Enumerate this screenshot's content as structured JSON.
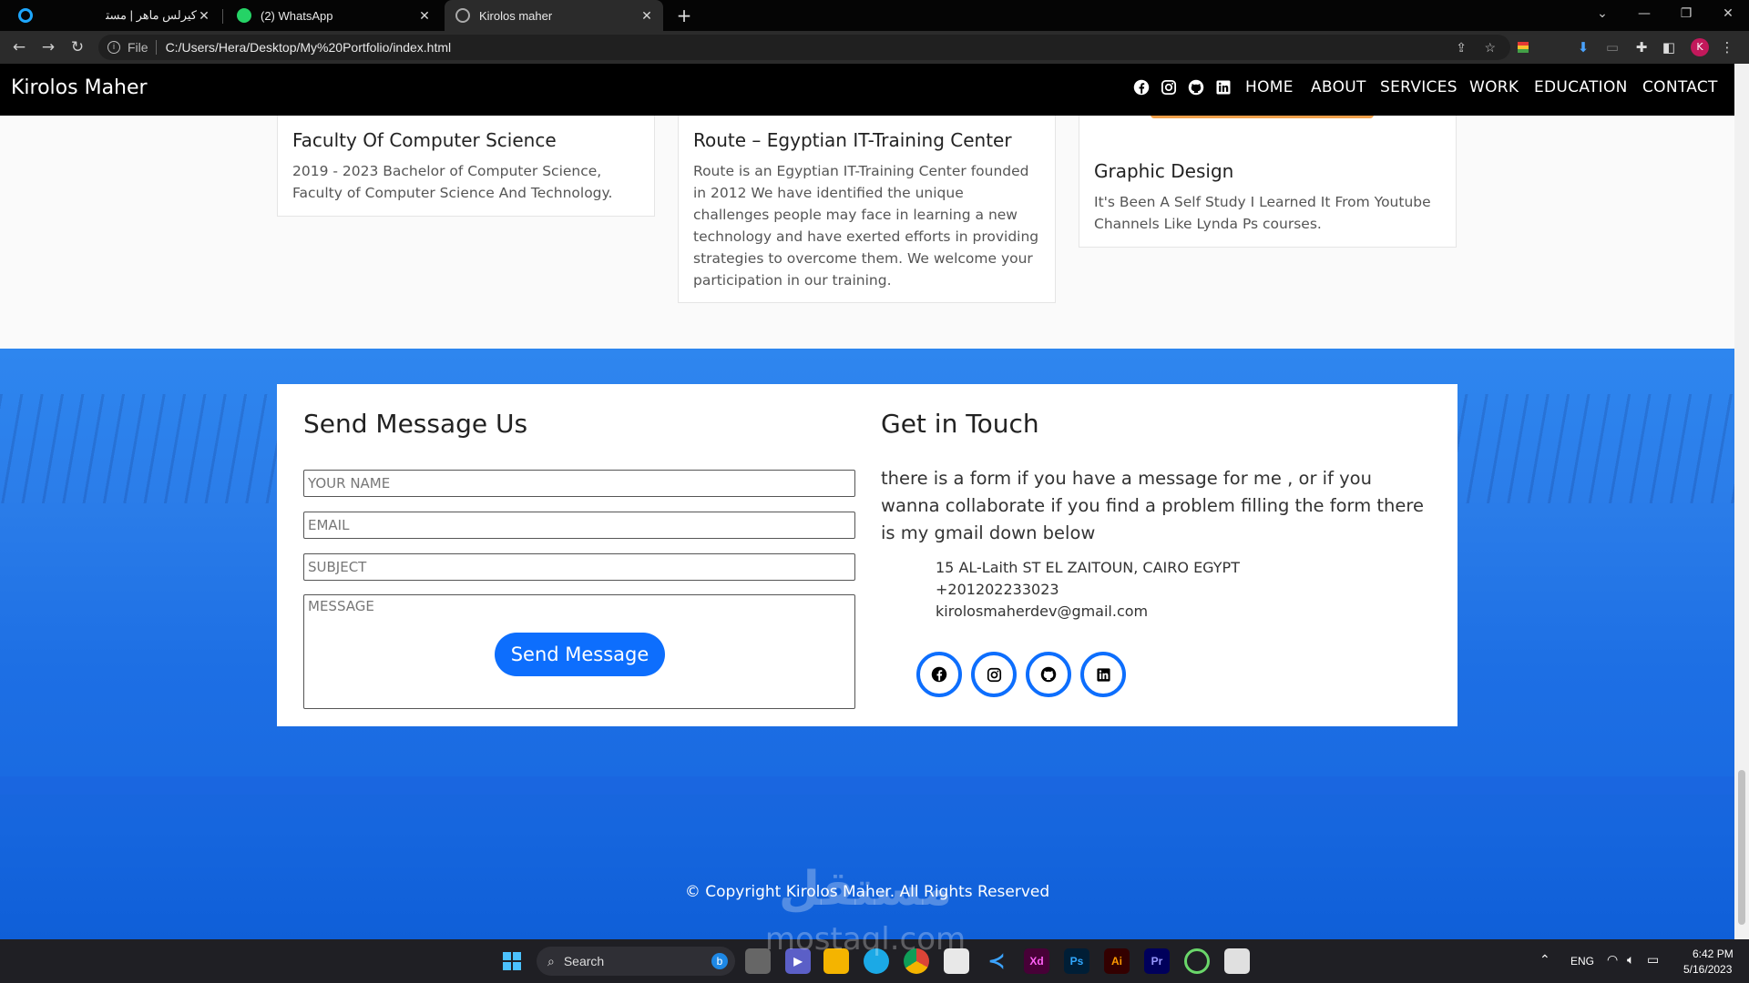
{
  "browser": {
    "tabs": [
      {
        "title": "كيرلس ماهر | مستقل",
        "active": false
      },
      {
        "title": "(2) WhatsApp",
        "active": false
      },
      {
        "title": "Kirolos maher",
        "active": true
      }
    ],
    "url_scheme": "File",
    "url": "C:/Users/Hera/Desktop/My%20Portfolio/index.html",
    "profile_initial": "K"
  },
  "navbar": {
    "brand": "Kirolos Maher",
    "social_icons": [
      "facebook-icon",
      "instagram-icon",
      "github-icon",
      "linkedin-icon"
    ],
    "links": [
      "HOME",
      "ABOUT",
      "SERVICES",
      "WORK",
      "EDUCATION",
      "CONTACT"
    ]
  },
  "education": {
    "cards": [
      {
        "title": "Faculty Of Computer Science",
        "text": "2019 - 2023 Bachelor of Computer Science, Faculty of Computer Science And Technology."
      },
      {
        "title": "Route – Egyptian IT-Training Center",
        "text": "Route is an Egyptian IT-Training Center founded in 2012 We have identified the unique challenges people may face in learning a new technology and have exerted efforts in providing strategies to overcome them. We welcome your participation in our training."
      },
      {
        "title": "Graphic Design",
        "text": "It's Been A Self Study I Learned It From Youtube Channels Like Lynda Ps courses."
      }
    ]
  },
  "contact": {
    "form_title": "Send Message Us",
    "placeholders": {
      "name": "YOUR NAME",
      "email": "EMAIL",
      "subject": "SUBJECT",
      "message": "MESSAGE"
    },
    "send_label": "Send Message",
    "touch_title": "Get in Touch",
    "touch_text": "there is a form if you have a message for me , or if you wanna collaborate if you find a problem filling the form there is my gmail down below",
    "address": "15 AL-Laith ST EL ZAITOUN, CAIRO EGYPT",
    "phone": "+201202233023",
    "email": "kirolosmaherdev@gmail.com",
    "social_icons": [
      "facebook-icon",
      "instagram-icon",
      "github-icon",
      "linkedin-icon"
    ],
    "accent": "#0d6efd"
  },
  "footer": {
    "text": "© Copyright Kirolos Maher. All Rights Reserved",
    "watermark": "مستقل",
    "watermark_sub": "mostaql.com"
  },
  "taskbar": {
    "search_label": "Search",
    "apps": [
      "Xd",
      "Ps",
      "Ai",
      "Pr"
    ],
    "language": "ENG",
    "time": "6:42 PM",
    "date": "5/16/2023"
  }
}
